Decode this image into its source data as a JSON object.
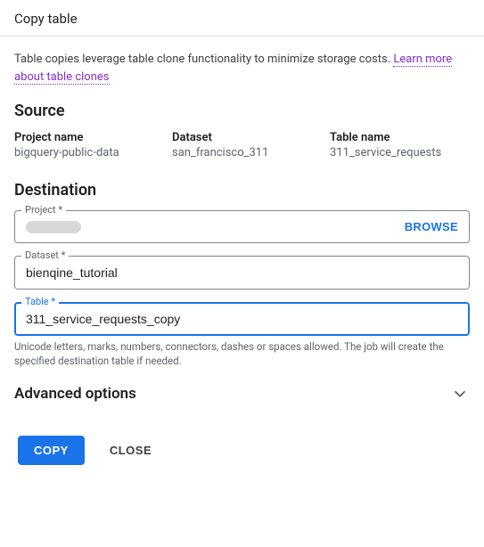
{
  "header": {
    "title": "Copy table"
  },
  "description": {
    "text1": "Table copies leverage table clone functionality to minimize storage costs. ",
    "link": "Learn more about table clones"
  },
  "source": {
    "title": "Source",
    "project_label": "Project name",
    "project_value": "bigquery-public-data",
    "dataset_label": "Dataset",
    "dataset_value": "san_francisco_311",
    "table_label": "Table name",
    "table_value": "311_service_requests"
  },
  "destination": {
    "title": "Destination",
    "project_label": "Project *",
    "project_value": "",
    "browse_label": "BROWSE",
    "dataset_label": "Dataset *",
    "dataset_value": "bienqine_tutorial",
    "table_label": "Table *",
    "table_value": "311_service_requests_copy",
    "table_helper": "Unicode letters, marks, numbers, connectors, dashes or spaces allowed. The job will create the specified destination table if needed."
  },
  "advanced": {
    "title": "Advanced options"
  },
  "actions": {
    "copy": "COPY",
    "close": "CLOSE"
  }
}
